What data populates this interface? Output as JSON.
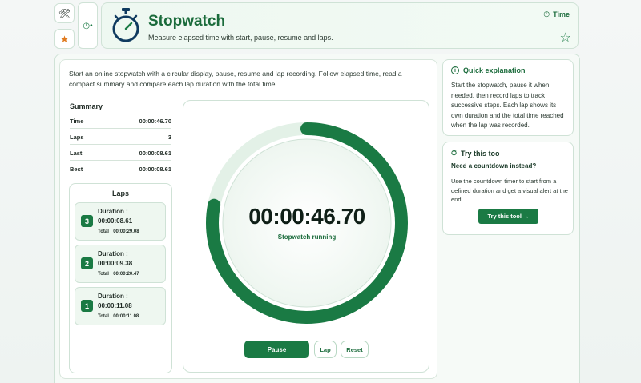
{
  "rail": {
    "tools_icon": "tools-icon",
    "favorites_icon": "star-icon",
    "category_icon": "clock-icon"
  },
  "header": {
    "title": "Stopwatch",
    "subtitle": "Measure elapsed time with start, pause, resume and laps.",
    "category": "Time"
  },
  "intro": "Start an online stopwatch with a circular display, pause, resume and lap recording. Follow elapsed time, read a compact summary and compare each lap duration with the total time.",
  "summary": {
    "title": "Summary",
    "rows": [
      {
        "label": "Time",
        "value": "00:00:46.70"
      },
      {
        "label": "Laps",
        "value": "3"
      },
      {
        "label": "Last",
        "value": "00:00:08.61"
      },
      {
        "label": "Best",
        "value": "00:00:08.61"
      }
    ]
  },
  "laps": {
    "title": "Laps",
    "items": [
      {
        "num": "3",
        "duration_label": "Duration :",
        "duration": "00:00:08.61",
        "total": "Total : 00:00:29.08"
      },
      {
        "num": "2",
        "duration_label": "Duration :",
        "duration": "00:00:09.38",
        "total": "Total : 00:00:20.47"
      },
      {
        "num": "1",
        "duration_label": "Duration :",
        "duration": "00:00:11.08",
        "total": "Total : 00:00:11.08"
      }
    ]
  },
  "stopwatch": {
    "time": "00:00:46.70",
    "status": "Stopwatch running",
    "progress_fraction": 0.78,
    "pause_label": "Pause",
    "lap_label": "Lap",
    "reset_label": "Reset"
  },
  "quick": {
    "title": "Quick explanation",
    "text": "Start the stopwatch, pause it when needed, then record laps to track successive steps. Each lap shows its own duration and the total time reached when the lap was recorded."
  },
  "try": {
    "title": "Try this too",
    "subtitle": "Need a countdown instead?",
    "text": "Use the countdown timer to start from a defined duration and get a visual alert at the end.",
    "button": "Try this tool  →"
  },
  "colors": {
    "accent": "#1a7a44",
    "ring_track": "#e3f1e7"
  }
}
